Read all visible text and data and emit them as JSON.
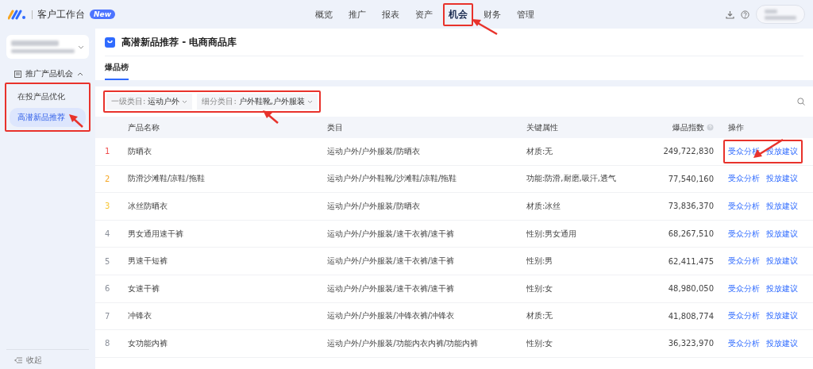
{
  "app": {
    "title": "客户工作台",
    "badge": "New"
  },
  "nav": [
    {
      "label": "概览",
      "selected": false,
      "highlighted": false
    },
    {
      "label": "推广",
      "selected": false,
      "highlighted": false
    },
    {
      "label": "报表",
      "selected": false,
      "highlighted": false
    },
    {
      "label": "资产",
      "selected": false,
      "highlighted": false
    },
    {
      "label": "机会",
      "selected": true,
      "highlighted": true
    },
    {
      "label": "财务",
      "selected": false,
      "highlighted": false
    },
    {
      "label": "管理",
      "selected": false,
      "highlighted": false
    }
  ],
  "sidebar": {
    "group": {
      "label": "推广产品机会",
      "expanded": true,
      "highlighted": true,
      "items": [
        {
          "label": "在投产品优化",
          "selected": false
        },
        {
          "label": "高潜新品推荐",
          "selected": true
        }
      ]
    },
    "collapse": "收起"
  },
  "page": {
    "title": "高潜新品推荐 - 电商商品库"
  },
  "tabs": [
    {
      "label": "爆品榜",
      "selected": true
    }
  ],
  "filters": {
    "highlighted": true,
    "items": [
      {
        "label": "一级类目:",
        "value": "运动户外"
      },
      {
        "label": "细分类目:",
        "value": "户外鞋靴,户外服装"
      }
    ]
  },
  "table": {
    "columns": [
      "产品名称",
      "类目",
      "关键属性",
      "爆品指数",
      "操作"
    ],
    "rows": [
      {
        "rank": "1",
        "color": "#f04b4b",
        "name": "防晒衣",
        "category": "运动户外/户外服装/防晒衣",
        "attribute": "材质:无",
        "index": "249,722,830",
        "actions": [
          "受众分析",
          "投放建议"
        ],
        "actions_highlighted": true
      },
      {
        "rank": "2",
        "color": "#f5a623",
        "name": "防滑沙滩鞋/凉鞋/拖鞋",
        "category": "运动户外/户外鞋靴/沙滩鞋/凉鞋/拖鞋",
        "attribute": "功能:防滑,耐磨,吸汗,透气",
        "index": "77,540,160",
        "actions": [
          "受众分析",
          "投放建议"
        ],
        "actions_highlighted": false
      },
      {
        "rank": "3",
        "color": "#f7c531",
        "name": "冰丝防晒衣",
        "category": "运动户外/户外服装/防晒衣",
        "attribute": "材质:冰丝",
        "index": "73,836,370",
        "actions": [
          "受众分析",
          "投放建议"
        ],
        "actions_highlighted": false
      },
      {
        "rank": "4",
        "color": "#8a8f99",
        "name": "男女通用速干裤",
        "category": "运动户外/户外服装/速干衣裤/速干裤",
        "attribute": "性别:男女通用",
        "index": "68,267,510",
        "actions": [
          "受众分析",
          "投放建议"
        ],
        "actions_highlighted": false
      },
      {
        "rank": "5",
        "color": "#8a8f99",
        "name": "男速干短裤",
        "category": "运动户外/户外服装/速干衣裤/速干裤",
        "attribute": "性别:男",
        "index": "62,411,475",
        "actions": [
          "受众分析",
          "投放建议"
        ],
        "actions_highlighted": false
      },
      {
        "rank": "6",
        "color": "#8a8f99",
        "name": "女速干裤",
        "category": "运动户外/户外服装/速干衣裤/速干裤",
        "attribute": "性别:女",
        "index": "48,980,050",
        "actions": [
          "受众分析",
          "投放建议"
        ],
        "actions_highlighted": false
      },
      {
        "rank": "7",
        "color": "#8a8f99",
        "name": "冲锋衣",
        "category": "运动户外/户外服装/冲锋衣裤/冲锋衣",
        "attribute": "材质:无",
        "index": "41,808,774",
        "actions": [
          "受众分析",
          "投放建议"
        ],
        "actions_highlighted": false
      },
      {
        "rank": "8",
        "color": "#8a8f99",
        "name": "女功能内裤",
        "category": "运动户外/户外服装/功能内衣内裤/功能内裤",
        "attribute": "性别:女",
        "index": "36,323,970",
        "actions": [
          "受众分析",
          "投放建议"
        ],
        "actions_highlighted": false
      }
    ]
  }
}
